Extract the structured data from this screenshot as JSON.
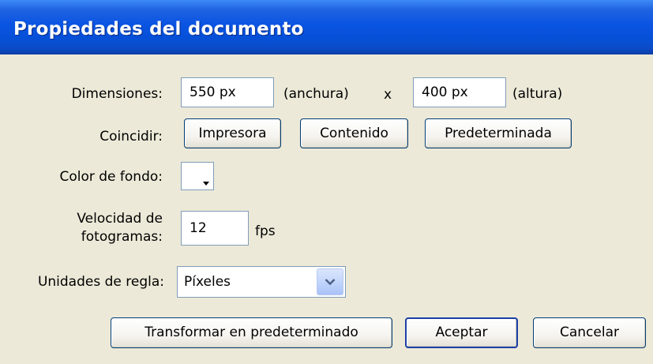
{
  "window": {
    "title": "Propiedades del documento"
  },
  "dimensions": {
    "label": "Dimensiones:",
    "width_value": "550 px",
    "width_label": "(anchura)",
    "separator": "x",
    "height_value": "400 px",
    "height_label": "(altura)"
  },
  "match": {
    "label": "Coincidir:",
    "printer_button": "Impresora",
    "contents_button": "Contenido",
    "default_button": "Predeterminada"
  },
  "background": {
    "label": "Color de fondo:",
    "color": "#ffffff"
  },
  "frame_rate": {
    "label_line1": "Velocidad de",
    "label_line2": "fotogramas:",
    "value": "12",
    "unit": "fps"
  },
  "ruler_units": {
    "label": "Unidades de regla:",
    "selected": "Píxeles"
  },
  "footer": {
    "make_default_button": "Transformar en predeterminado",
    "ok_button": "Aceptar",
    "cancel_button": "Cancelar"
  }
}
